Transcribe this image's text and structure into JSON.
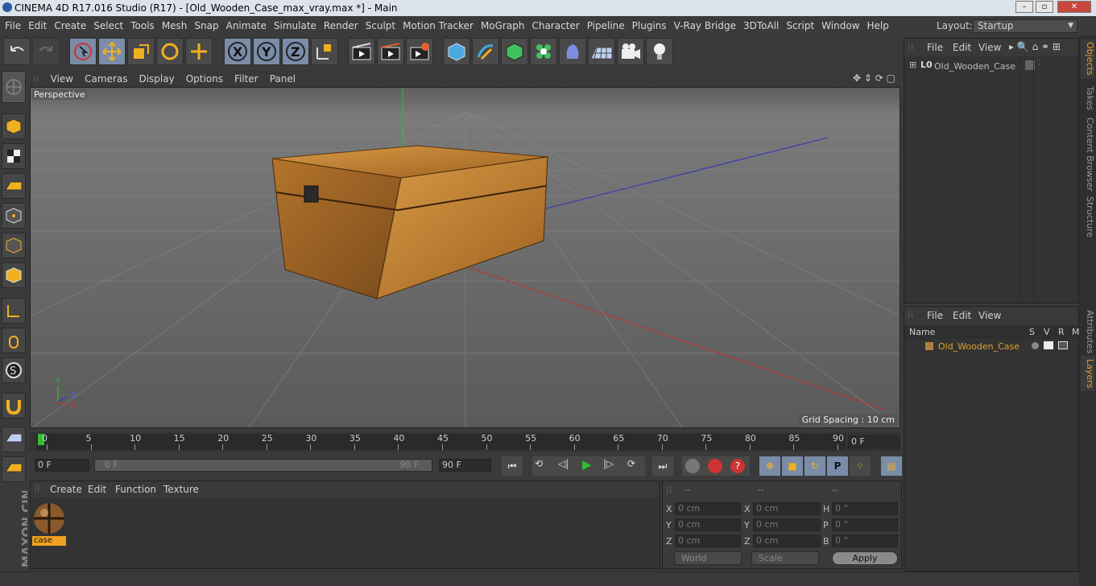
{
  "window": {
    "title": "CINEMA 4D R17.016 Studio (R17) - [Old_Wooden_Case_max_vray.max *] - Main"
  },
  "menu": [
    "File",
    "Edit",
    "Create",
    "Select",
    "Tools",
    "Mesh",
    "Snap",
    "Animate",
    "Simulate",
    "Render",
    "Sculpt",
    "Motion Tracker",
    "MoGraph",
    "Character",
    "Pipeline",
    "Plugins",
    "V-Ray Bridge",
    "3DToAll",
    "Script",
    "Window",
    "Help"
  ],
  "layout": {
    "label": "Layout:",
    "value": "Startup"
  },
  "viewport": {
    "menu": [
      "View",
      "Cameras",
      "Display",
      "Options",
      "Filter",
      "Panel"
    ],
    "name": "Perspective",
    "grid_spacing": "Grid Spacing : 10 cm"
  },
  "timeline": {
    "ticks": [
      "0",
      "5",
      "10",
      "15",
      "20",
      "25",
      "30",
      "35",
      "40",
      "45",
      "50",
      "55",
      "60",
      "65",
      "70",
      "75",
      "80",
      "85",
      "90"
    ],
    "current_frame": "0 F"
  },
  "playbar": {
    "start": "0 F",
    "range_start": "0 F",
    "range_end": "90 F",
    "end": "90 F"
  },
  "material": {
    "menu": [
      "Create",
      "Edit",
      "Function",
      "Texture"
    ],
    "item_label": "case"
  },
  "coords": {
    "headers": [
      "--",
      "--",
      "--"
    ],
    "pos": [
      {
        "l": "X",
        "v": "0 cm"
      },
      {
        "l": "Y",
        "v": "0 cm"
      },
      {
        "l": "Z",
        "v": "0 cm"
      }
    ],
    "size": [
      {
        "l": "X",
        "v": "0 cm"
      },
      {
        "l": "Y",
        "v": "0 cm"
      },
      {
        "l": "Z",
        "v": "0 cm"
      }
    ],
    "rot": [
      {
        "l": "H",
        "v": "0 °"
      },
      {
        "l": "P",
        "v": "0 °"
      },
      {
        "l": "B",
        "v": "0 °"
      }
    ],
    "world": "World",
    "scale": "Scale",
    "apply": "Apply"
  },
  "objects": {
    "menu": [
      "File",
      "Edit",
      "View"
    ],
    "item": "Old_Wooden_Case"
  },
  "layers": {
    "menu": [
      "File",
      "Edit",
      "View"
    ],
    "cols": [
      "Name",
      "S",
      "V",
      "R",
      "M"
    ],
    "item": "Old_Wooden_Case",
    "item_color": "#e0a030"
  },
  "sidetabs": [
    "Objects",
    "Takes",
    "Content Browser",
    "Structure",
    "Attributes",
    "Layers"
  ],
  "brand": "MAXON CINEMA 4D",
  "axis": {
    "y": "Y",
    "z": "Z",
    "x": "X"
  }
}
